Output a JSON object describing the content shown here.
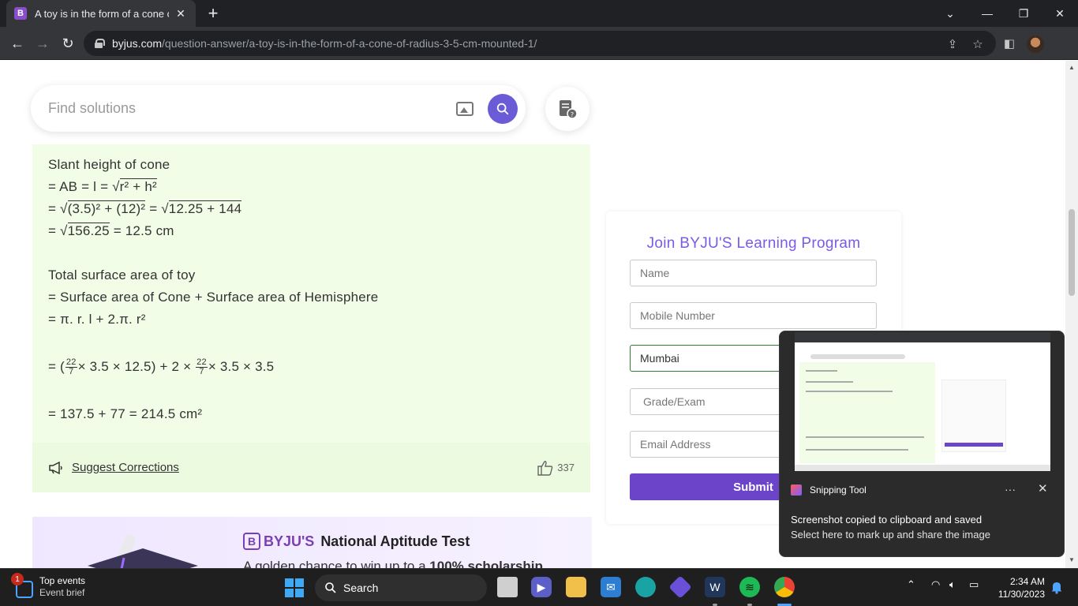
{
  "browser": {
    "tab_title": "A toy is in the form of a cone of",
    "tab_favicon": "B",
    "url_domain": "byjus.com",
    "url_path": "/question-answer/a-toy-is-in-the-form-of-a-cone-of-radius-3-5-cm-mounted-1/"
  },
  "search": {
    "placeholder": "Find solutions"
  },
  "solution": {
    "lines": [
      "Slant height of cone",
      "= AB = l = √",
      "r² + h²",
      "= √",
      "(3.5)² + (12)²",
      " = √",
      "12.25 + 144",
      "= √",
      "156.25",
      " = 12.5 cm",
      "Total surface area of toy",
      "= Surface area of Cone + Surface area of Hemisphere",
      "= π. r. l + 2.π. r²",
      "= (",
      "× 3.5 × 12.5) + 2 × ",
      "× 3.5 × 3.5",
      "= 137.5 + 77 = 214.5 cm²"
    ],
    "frac_num": "22",
    "frac_den": "7"
  },
  "suggest": {
    "label": "Suggest Corrections",
    "likes": "337"
  },
  "banner": {
    "brand": "BYJU'S",
    "logo_mark": "B",
    "title": "National Aptitude Test",
    "subtitle_prefix": "A golden chance to win up to a ",
    "subtitle_bold": "100% scholarship"
  },
  "form": {
    "title": "Join BYJU'S Learning Program",
    "name_placeholder": "Name",
    "mobile_placeholder": "Mobile Number",
    "city_value": "Mumbai",
    "grade_placeholder": "Grade/Exam",
    "email_placeholder": "Email Address",
    "submit_label": "Submit"
  },
  "toast": {
    "app_name": "Snipping Tool",
    "more": "···",
    "heading": "Screenshot copied to clipboard and saved",
    "body": "Select here to mark up and share the image"
  },
  "taskbar": {
    "widget_badge": "1",
    "widget_title": "Top events",
    "widget_sub": "Event brief",
    "search_label": "Search",
    "time": "2:34 AM",
    "date": "11/30/2023"
  },
  "colors": {
    "accent_purple": "#6b44c9",
    "answer_bg": "#f2fde8",
    "form_title": "#7a5ae6"
  }
}
